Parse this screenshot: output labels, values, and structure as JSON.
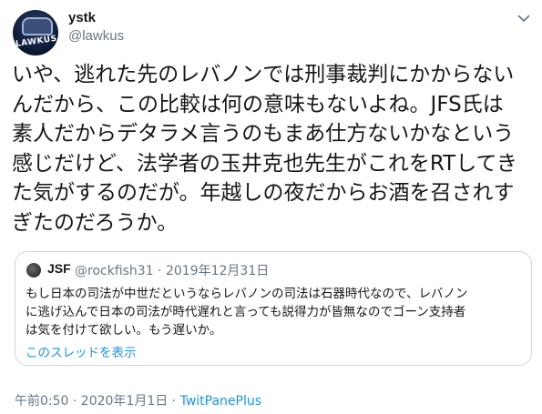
{
  "author": {
    "display_name": "ystk",
    "handle": "@lawkus",
    "avatar_logo_text": "LAWKUS"
  },
  "tweet": {
    "text": "いや、逃れた先のレバノンでは刑事裁判にかからない\nんだから、この比較は何の意味もないよね。JFS氏は\n素人だからデタラメ言うのもまあ仕方ないかなという\n感じだけど、法学者の玉井克也先生がこれをRTしてき\nた気がするのだが。年越しの夜だからお酒を召されす\nぎたのだろうか。"
  },
  "quoted": {
    "display_name": "JSF",
    "meta": "@rockfish31 · 2019年12月31日",
    "text": "もし日本の司法が中世だというならレバノンの司法は石器時代なので、レバノン\nに逃げ込んで日本の司法が時代遅れと言っても説得力が皆無なのでゴーン支持者\nは気を付けて欲しい。もう遅いか。",
    "thread_link": "このスレッドを表示"
  },
  "footer": {
    "timestamp": "午前0:50 · 2020年1月1日 · ",
    "client": "TwitPanePlus"
  },
  "colors": {
    "text": "#14171a",
    "secondary": "#657786",
    "link": "#1b95e0",
    "border": "#ccd6dd"
  }
}
